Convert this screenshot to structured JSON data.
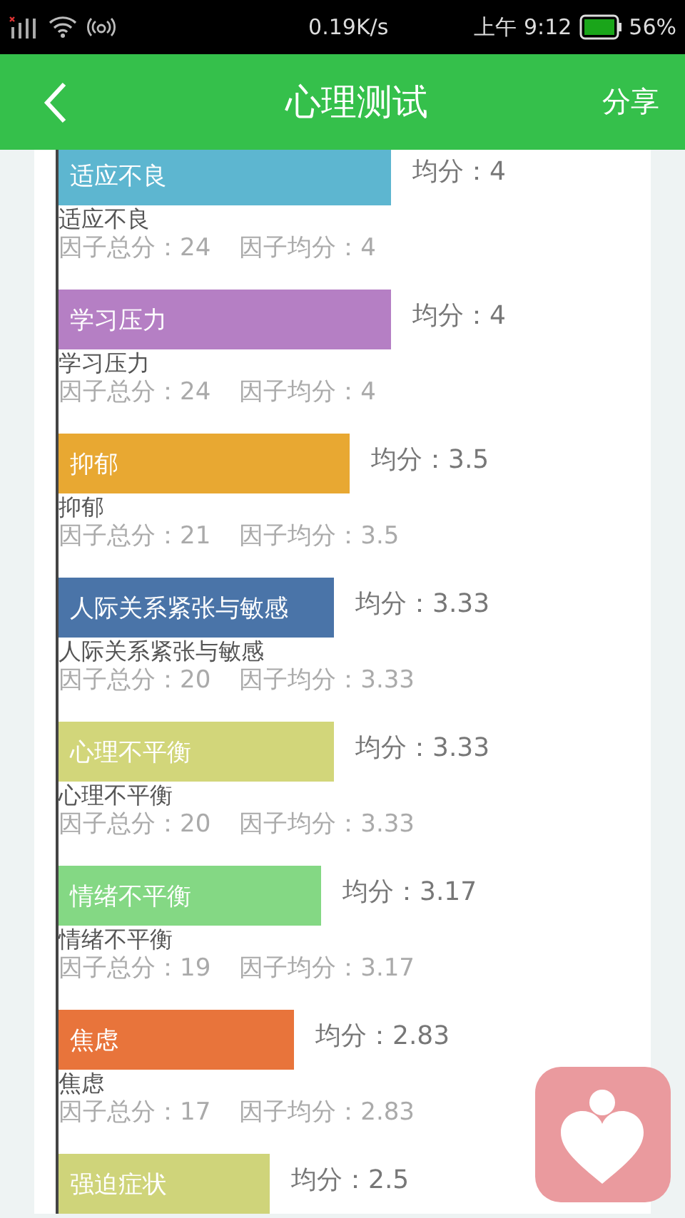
{
  "status_bar": {
    "network_speed": "0.19K/s",
    "time": "上午 9:12",
    "battery": "56%"
  },
  "header": {
    "title": "心理测试",
    "action": "分享"
  },
  "factors": [
    {
      "bar_label": "适应不良",
      "average": "均分：4",
      "color": "#5db6d0",
      "name": "适应不良",
      "total": "因子总分：24",
      "mean": "因子均分：4"
    },
    {
      "bar_label": "学习压力",
      "average": "均分：4",
      "color": "#b57fc4",
      "name": "学习压力",
      "total": "因子总分：24",
      "mean": "因子均分：4"
    },
    {
      "bar_label": "抑郁",
      "average": "均分：3.5",
      "color": "#e8a832",
      "name": "抑郁",
      "total": "因子总分：21",
      "mean": "因子均分：3.5"
    },
    {
      "bar_label": "人际关系紧张与敏感",
      "average": "均分：3.33",
      "color": "#4a74a8",
      "name": "人际关系紧张与敏感",
      "total": "因子总分：20",
      "mean": "因子均分：3.33"
    },
    {
      "bar_label": "心理不平衡",
      "average": "均分：3.33",
      "color": "#d2d67a",
      "name": "心理不平衡",
      "total": "因子总分：20",
      "mean": "因子均分：3.33"
    },
    {
      "bar_label": "情绪不平衡",
      "average": "均分：3.17",
      "color": "#84d884",
      "name": "情绪不平衡",
      "total": "因子总分：19",
      "mean": "因子均分：3.17"
    },
    {
      "bar_label": "焦虑",
      "average": "均分：2.83",
      "color": "#e8743b",
      "name": "焦虑",
      "total": "因子总分：17",
      "mean": "因子均分：2.83"
    },
    {
      "bar_label": "强迫症状",
      "average": "均分：2.5",
      "color": "#cfd47a"
    }
  ]
}
